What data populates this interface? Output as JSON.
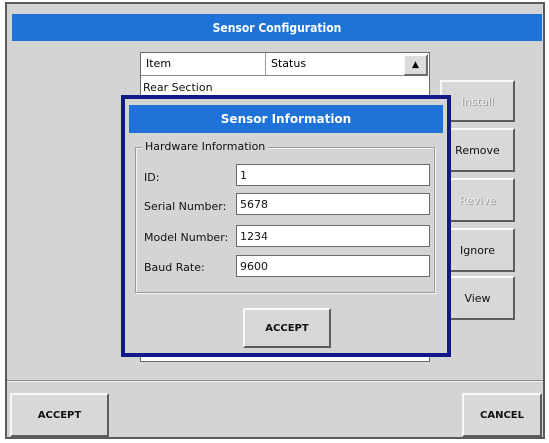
{
  "window": {
    "title": "Sensor Configuration"
  },
  "list": {
    "columns": [
      "Item",
      "Status"
    ],
    "rows": [
      {
        "item": "Rear Section",
        "status": ""
      }
    ],
    "scroll_up_glyph": "▲"
  },
  "side_buttons": {
    "install": "Install",
    "remove": "Remove",
    "revive": "Revive",
    "ignore": "Ignore",
    "view": "View"
  },
  "footer": {
    "accept": "ACCEPT",
    "cancel": "CANCEL"
  },
  "dialog": {
    "title": "Sensor Information",
    "group_label": "Hardware Information",
    "fields": {
      "id": {
        "label": "ID:",
        "value": "1"
      },
      "serial": {
        "label": "Serial Number:",
        "value": "5678"
      },
      "model": {
        "label": "Model Number:",
        "value": "1234"
      },
      "baud": {
        "label": "Baud Rate:",
        "value": "9600"
      }
    },
    "accept": "ACCEPT"
  },
  "colors": {
    "titlebar": "#1e72d8",
    "dialog_border": "#121a8a",
    "window_bg": "#d4d4d4"
  }
}
